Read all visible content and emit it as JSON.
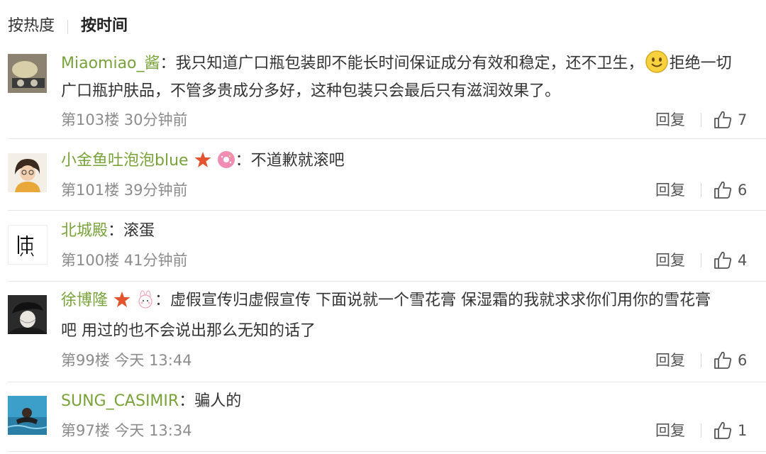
{
  "sort_bar": {
    "hot_label": "按热度",
    "time_label": "按时间"
  },
  "colors": {
    "username": "#79a33a",
    "meta": "#8c8c8c",
    "divider": "#e6e6e6"
  },
  "comments": [
    {
      "user": "Miaomiao_酱",
      "colon": "：",
      "text_line1_a": "我只知道广口瓶包装即不能长时间保证成分有效和稳定，还不卫生，",
      "inline_emoji": "smiley-face-emoji",
      "text_line1_b": "拒绝一切",
      "text_line2": "广口瓶护肤品，不管多贵成分多好，这种包装只会最后只有滋润效果了。",
      "meta": "第103楼 30分钟前",
      "reply": "回复",
      "likes": "7"
    },
    {
      "user": "小金鱼吐泡泡blue",
      "badges": [
        "star-badge-icon",
        "donut-badge-icon"
      ],
      "colon": "：",
      "text_line1": "不道歉就滚吧",
      "meta": "第101楼 39分钟前",
      "reply": "回复",
      "likes": "6"
    },
    {
      "user": "北城殿",
      "colon": "：",
      "text_line1": "滚蛋",
      "meta": "第100楼 41分钟前",
      "reply": "回复",
      "likes": "4"
    },
    {
      "user": "徐博隆",
      "badges": [
        "star-badge-icon",
        "bunny-badge-icon"
      ],
      "colon": "：",
      "text_line1": "虚假宣传归虚假宣传  下面说就一个雪花膏 保湿霜的我就求求你们用你的雪花膏",
      "text_line2": "吧  用过的也不会说出那么无知的话了",
      "meta": "第99楼 今天 13:44",
      "reply": "回复",
      "likes": "6"
    },
    {
      "user": "SUNG_CASIMIR",
      "colon": "：",
      "text_line1": "骗人的",
      "meta": "第97楼 今天 13:34",
      "reply": "回复",
      "likes": "1"
    }
  ]
}
